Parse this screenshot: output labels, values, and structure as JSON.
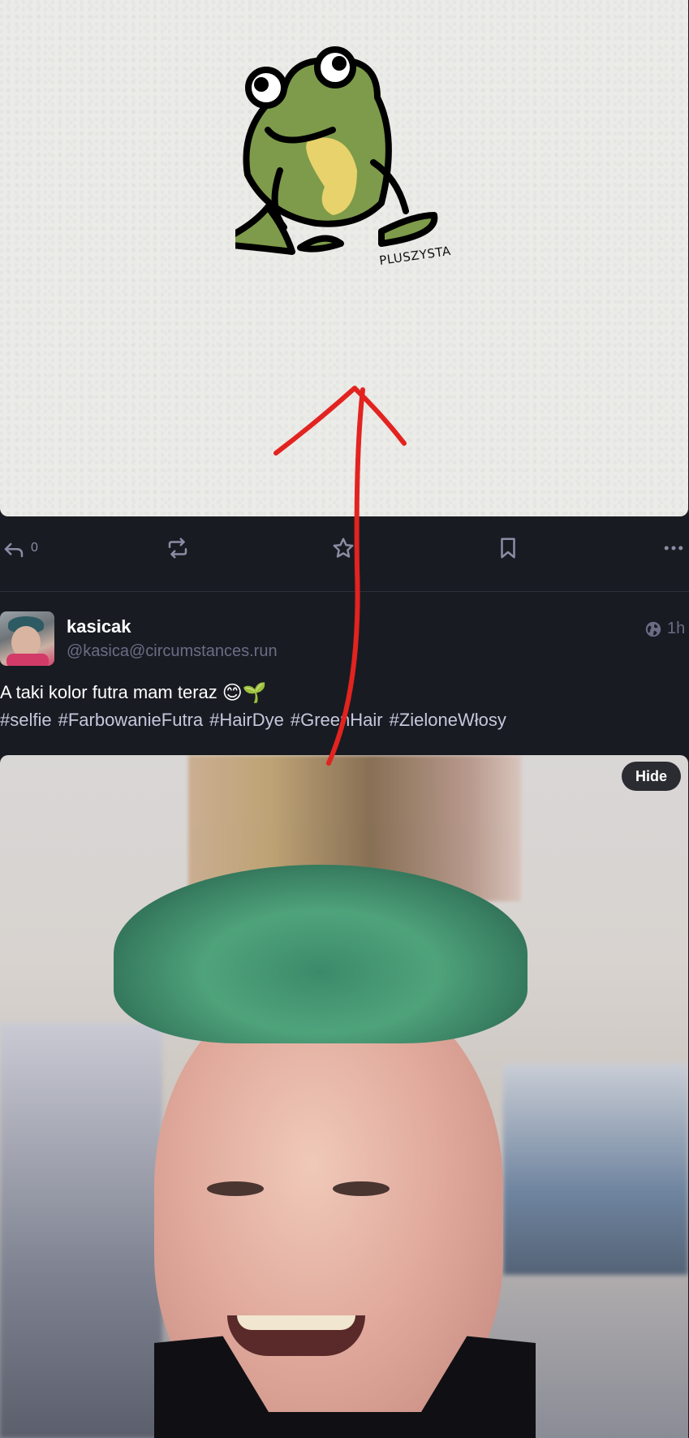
{
  "colors": {
    "background": "#191b22",
    "muted": "#6a6d85",
    "hashtag": "#c5c8dd",
    "annotation": "#e2231f",
    "frog_body": "#7d9b4a",
    "frog_belly": "#e8d26b"
  },
  "post1": {
    "image_signature": "PLUSZYSTA",
    "actions": {
      "reply_count": "0",
      "reply_icon": "reply-icon",
      "boost_icon": "boost-icon",
      "favourite_icon": "star-icon",
      "bookmark_icon": "bookmark-icon",
      "more_icon": "more-icon"
    }
  },
  "post2": {
    "display_name": "kasicak",
    "account": "@kasica@circumstances.run",
    "visibility_icon": "globe-icon",
    "time": "1h",
    "text": "A taki kolor futra mam teraz",
    "emoji": "😊🌱",
    "hashtags": [
      "#selfie",
      "#FarbowanieFutra",
      "#HairDye",
      "#GreenHair",
      "#ZieloneWłosy"
    ],
    "hide_label": "Hide"
  }
}
